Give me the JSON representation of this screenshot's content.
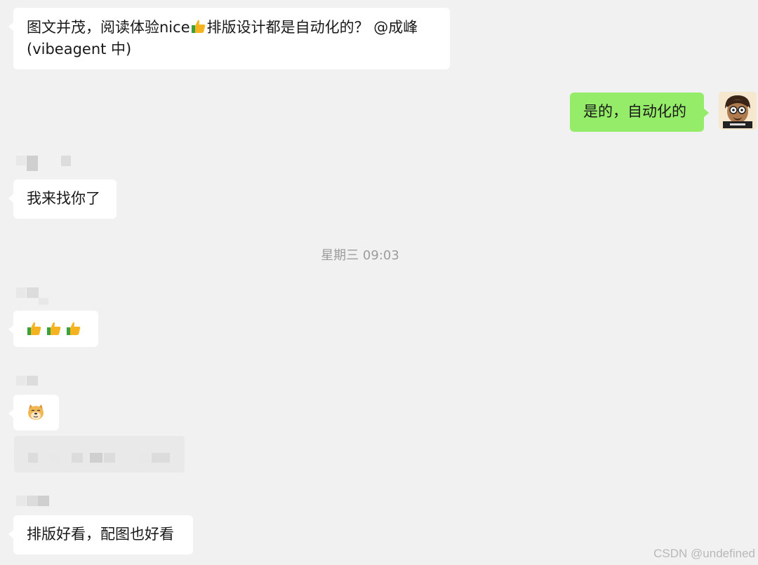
{
  "messages": [
    {
      "side": "left",
      "line1": "图文并茂，阅读体验nice",
      "emoji": "thumbs-up",
      "line1_tail": "排版设计都是自动化的？ @成峰",
      "line2": "(vibeagent 中)"
    },
    {
      "side": "right",
      "text": "是的，自动化的"
    },
    {
      "side": "left",
      "text": "我来找你了"
    },
    {
      "side": "left",
      "emoji": "thumbs-up ×3"
    },
    {
      "side": "left",
      "emoji": "doge"
    },
    {
      "side": "left",
      "text": "排版好看，配图也好看"
    }
  ],
  "timestamp": "星期三 09:03",
  "watermark": "CSDN @undefined",
  "colors": {
    "background": "#f1f1f1",
    "bubble_left": "#ffffff",
    "bubble_right": "#95ec69"
  }
}
